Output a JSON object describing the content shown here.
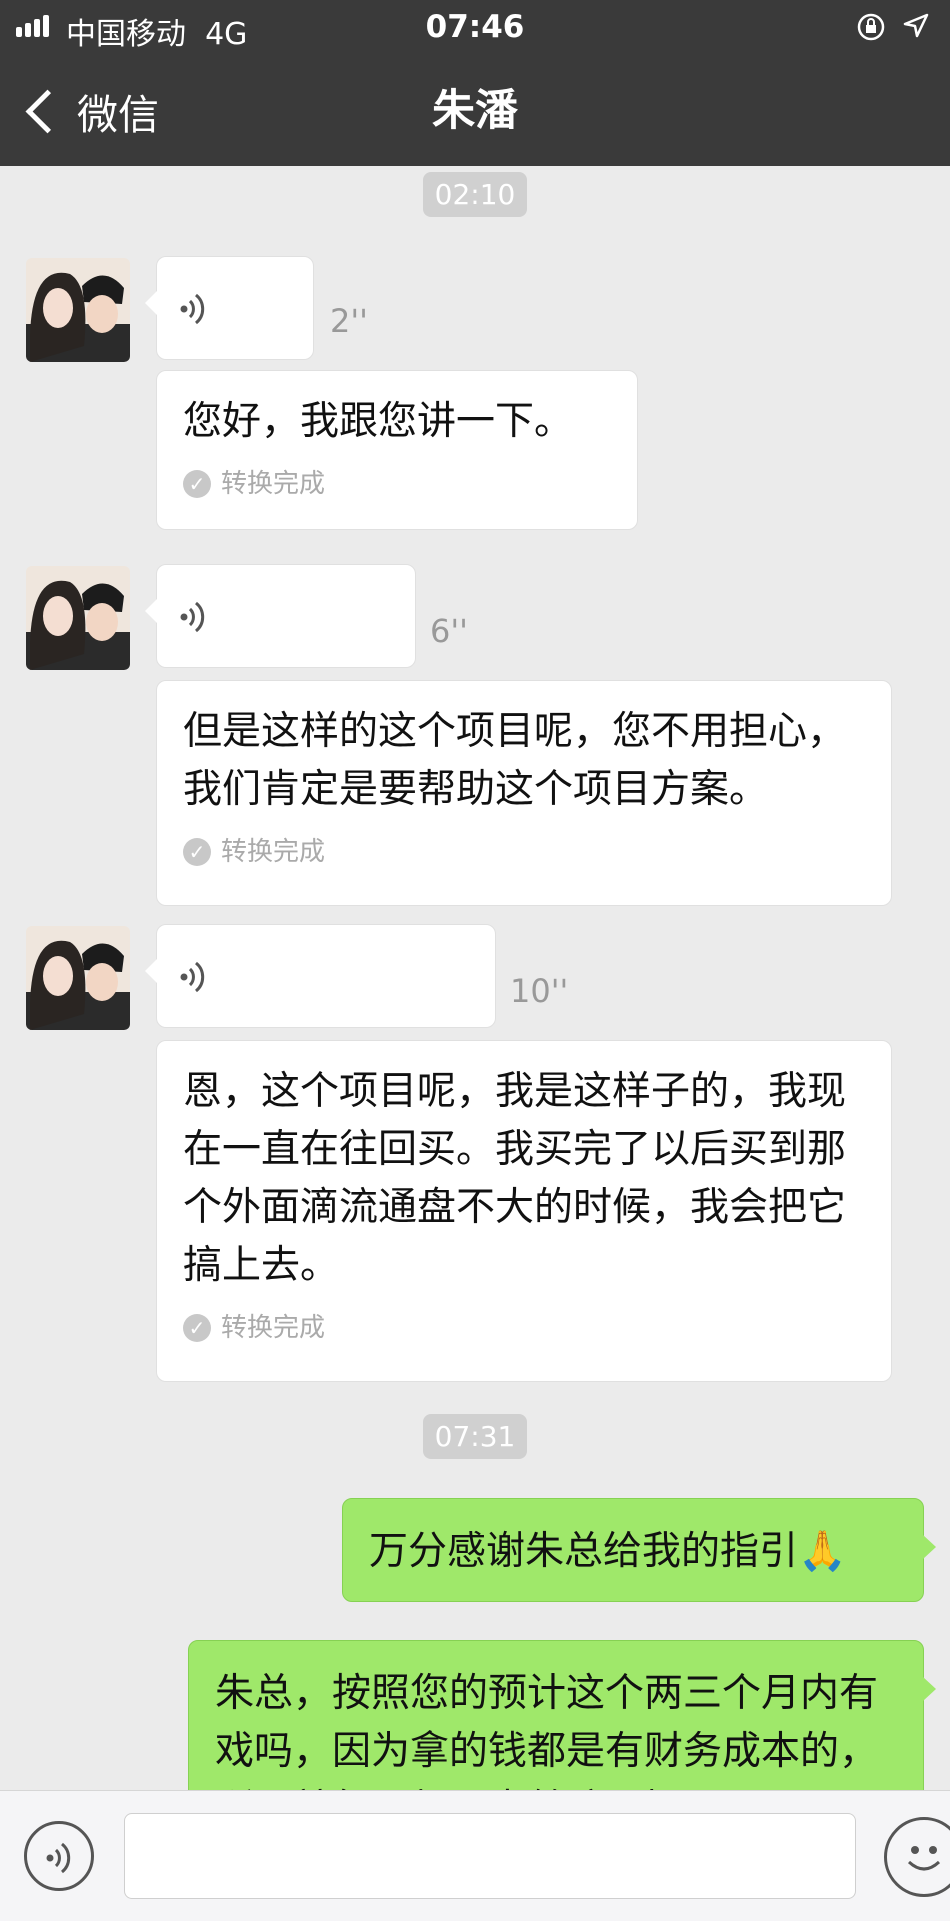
{
  "status_bar": {
    "carrier": "中国移动",
    "network": "4G",
    "time": "07:46"
  },
  "nav": {
    "back_label": "微信",
    "title": "朱潘"
  },
  "messages": [
    {
      "timestamp": "02:10"
    },
    {
      "voice_duration": "2''",
      "transcript": "您好，我跟您讲一下。",
      "status": "转换完成"
    },
    {
      "voice_duration": "6''",
      "transcript": "但是这样的这个项目呢，您不用担心，我们肯定是要帮助这个项目方案。",
      "status": "转换完成"
    },
    {
      "voice_duration": "10''",
      "transcript": "恩，这个项目呢，我是这样子的，我现在一直在往回买。我买完了以后买到那个外面滴流通盘不大的时候，我会把它搞上去。",
      "status": "转换完成"
    },
    {
      "timestamp": "07:31"
    },
    {
      "text": "万分感谢朱总给我的指引🙏"
    },
    {
      "text": "朱总，按照您的预计这个两三个月内有戏吗，因为拿的钱都是有财务成本的，所以就每天都风声鹤唳，提心吊"
    }
  ],
  "icons": {
    "signal": "signal-icon",
    "lock": "rotation-lock-icon",
    "location": "location-arrow-icon",
    "back": "chevron-left-icon",
    "voice": "voice-wave-icon",
    "check": "check-circle-icon",
    "voice_input": "voice-input-icon",
    "emoji": "emoji-icon",
    "avatar": "avatar"
  },
  "colors": {
    "bar": "#3a3a3a",
    "chat_bg": "#ebebeb",
    "green_bubble": "#9fe86a"
  }
}
